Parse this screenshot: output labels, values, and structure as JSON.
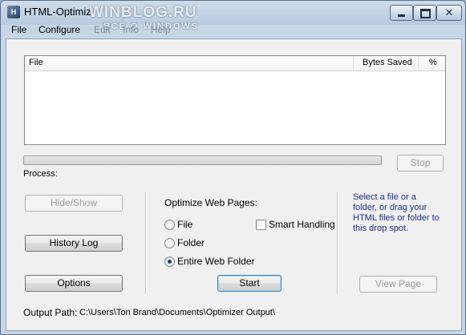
{
  "window": {
    "title": "HTML-Optimiz",
    "watermark": "WINBLOG.RU",
    "watermark_sub": "ВСЁ О WINDOWS"
  },
  "menu": {
    "items": [
      "File",
      "Configure",
      "Edit",
      "Info",
      "Help"
    ]
  },
  "list": {
    "columns": [
      "File",
      "Bytes Saved",
      "%"
    ]
  },
  "progress": {
    "stop_label": "Stop",
    "process_label": "Process:",
    "value": 0
  },
  "left_buttons": {
    "hide_show": "Hide/Show",
    "history_log": "History Log",
    "options": "Options"
  },
  "optimize": {
    "heading": "Optimize Web Pages:",
    "options": [
      "File",
      "Folder",
      "Entire Web Folder"
    ],
    "selected": "Entire Web Folder",
    "smart_handling": "Smart Handling",
    "start_label": "Start"
  },
  "drop": {
    "hint_lines": [
      "Select a file or a",
      "folder, or drag your",
      "HTML files or folder to",
      "this drop spot."
    ],
    "view_page": "View Page"
  },
  "output": {
    "label": "Output Path:",
    "path": "C:\\Users\\Ton Brand\\Documents\\Optimizer Output\\"
  }
}
